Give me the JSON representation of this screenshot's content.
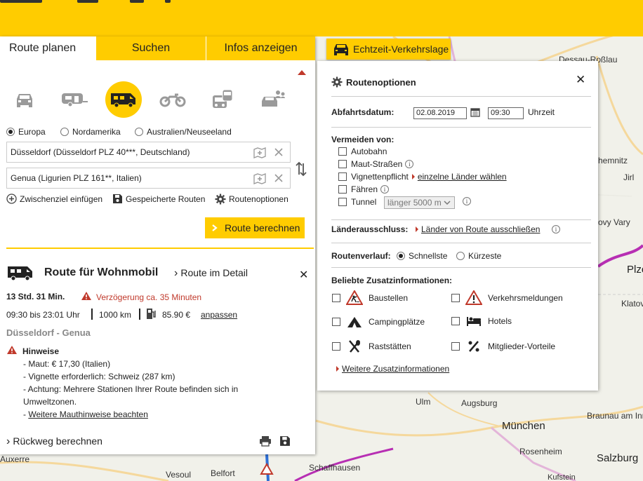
{
  "map": {
    "cities": [
      {
        "name": "Dessau-Roßlau"
      },
      {
        "name": "hemnitz"
      },
      {
        "name": "Jirl"
      },
      {
        "name": "ovy Vary"
      },
      {
        "name": "Plze"
      },
      {
        "name": "Klatov"
      },
      {
        "name": "Ulm"
      },
      {
        "name": "Augsburg"
      },
      {
        "name": "München"
      },
      {
        "name": "Braunau am Inn"
      },
      {
        "name": "Rosenheim"
      },
      {
        "name": "Salzburg"
      },
      {
        "name": "Schaffhausen"
      },
      {
        "name": "Kufstein"
      },
      {
        "name": "Auxerre"
      },
      {
        "name": "Vesoul"
      },
      {
        "name": "Belfort"
      }
    ]
  },
  "tabs": [
    {
      "label": "Route planen",
      "active": true
    },
    {
      "label": "Suchen",
      "active": false
    },
    {
      "label": "Infos anzeigen",
      "active": false
    }
  ],
  "vehicles": [
    {
      "icon": "car-icon",
      "selected": false
    },
    {
      "icon": "caravan-icon",
      "selected": false
    },
    {
      "icon": "motorhome-icon",
      "selected": true
    },
    {
      "icon": "motorcycle-icon",
      "selected": false
    },
    {
      "icon": "public-transport-icon",
      "selected": false
    },
    {
      "icon": "carpool-icon",
      "selected": false
    }
  ],
  "regions": [
    {
      "label": "Europa",
      "selected": true
    },
    {
      "label": "Nordamerika",
      "selected": false
    },
    {
      "label": "Australien/Neuseeland",
      "selected": false
    }
  ],
  "route": {
    "from": "Düsseldorf (Düsseldorf PLZ 40***, Deutschland)",
    "to": "Genua (Ligurien PLZ 161**, Italien)"
  },
  "links": {
    "waypoint": "Zwischenziel einfügen",
    "saved": "Gespeicherte Routen",
    "options": "Routenoptionen"
  },
  "calc_button": "Route berechnen",
  "result": {
    "title": "Route für Wohnmobil",
    "detail": "Route im Detail",
    "duration": "13 Std. 31 Min.",
    "delay": "Verzögerung ca. 35 Minuten",
    "times": "09:30 bis 23:01 Uhr",
    "distance": "1000 km",
    "cost": "85.90 €",
    "adjust": "anpassen",
    "route_name": "Düsseldorf - Genua",
    "notes_title": "Hinweise",
    "notes": [
      "- Maut: € 17,30 (Italien)",
      "- Vignette erforderlich: Schweiz (287 km)",
      "- Achtung: Mehrere Stationen Ihrer Route befinden sich in",
      "Umweltzonen."
    ],
    "toll_link_prefix": "- ",
    "toll_link": "Weitere Mauthinweise beachten",
    "return_route": "Rückweg berechnen"
  },
  "traffic_badge": "Echtzeit-Verkehrslage",
  "options": {
    "title": "Routenoptionen",
    "departure_label": "Abfahrtsdatum:",
    "date": "02.08.2019",
    "time": "09:30",
    "time_unit": "Uhrzeit",
    "avoid_label": "Vermeiden von:",
    "avoid": [
      {
        "label": "Autobahn",
        "checked": false,
        "info": false
      },
      {
        "label": "Maut-Straßen",
        "checked": false,
        "info": true
      },
      {
        "label": "Vignettenpflicht",
        "checked": false,
        "info": false,
        "link": "einzelne Länder wählen"
      },
      {
        "label": "Fähren",
        "checked": false,
        "info": true
      },
      {
        "label": "Tunnel",
        "checked": false,
        "info": true,
        "select": "länger 5000 m"
      }
    ],
    "country_exclusion_label": "Länderausschluss:",
    "country_exclusion_link": "Länder von Route ausschließen",
    "route_type_label": "Routenverlauf:",
    "route_types": [
      {
        "label": "Schnellste",
        "selected": true
      },
      {
        "label": "Kürzeste",
        "selected": false
      }
    ],
    "extras_label": "Beliebte Zusatzinformationen:",
    "extras": [
      {
        "label": "Baustellen",
        "icon": "construction-icon"
      },
      {
        "label": "Verkehrsmeldungen",
        "icon": "traffic-warning-icon"
      },
      {
        "label": "Campingplätze",
        "icon": "camping-icon"
      },
      {
        "label": "Hotels",
        "icon": "hotel-icon"
      },
      {
        "label": "Raststätten",
        "icon": "restaurant-icon"
      },
      {
        "label": "Mitglieder-Vorteile",
        "icon": "discount-icon"
      }
    ],
    "more_link": "Weitere Zusatzinformationen"
  }
}
